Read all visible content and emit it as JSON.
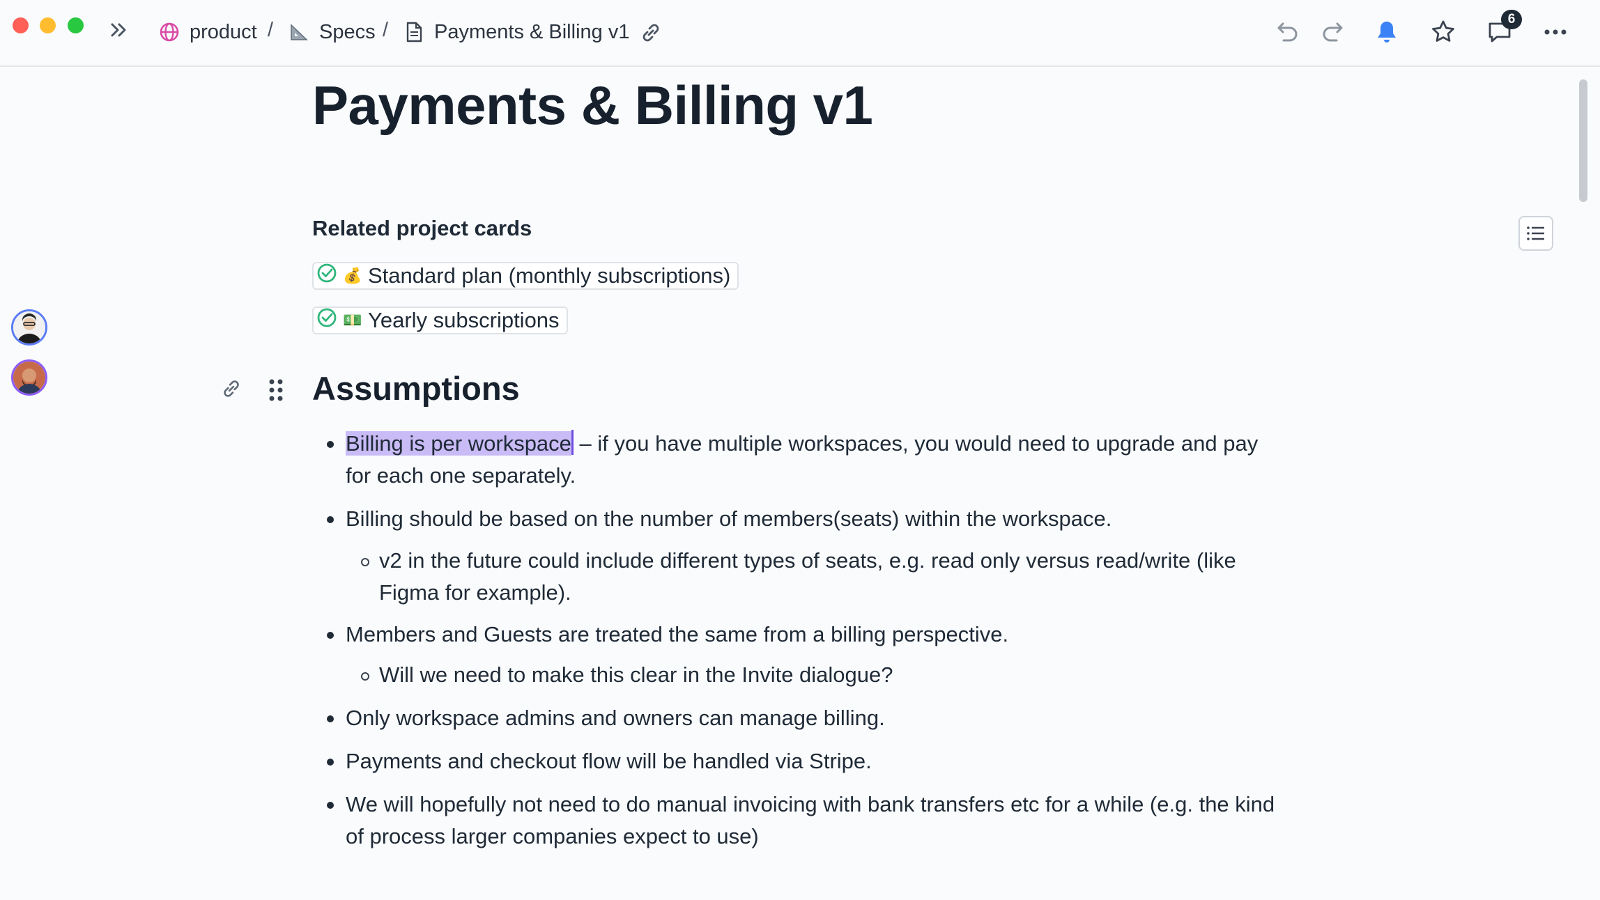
{
  "breadcrumb": {
    "workspace": "product",
    "folder": "Specs",
    "page": "Payments & Billing v1",
    "separator": "/"
  },
  "toolbar": {
    "comments_count": "6"
  },
  "document": {
    "title": "Payments & Billing v1",
    "related_heading": "Related project cards",
    "related_cards": [
      {
        "emoji": "💰",
        "label": "Standard plan (monthly subscriptions)",
        "status": "done"
      },
      {
        "emoji": "💵",
        "label": "Yearly subscriptions",
        "status": "done"
      }
    ],
    "section_heading": "Assumptions",
    "bullets": {
      "b1_highlight": "Billing is per workspace",
      "b1_rest": " – if you have multiple workspaces, you would need to upgrade and pay for each one separately.",
      "b2": "Billing should be based on the number of members(seats) within the workspace.",
      "b2_sub": "v2 in the future could include different types of seats, e.g. read only versus read/write (like Figma for example).",
      "b3": "Members and Guests are treated the same from a billing perspective.",
      "b3_sub": "Will we need to make this clear in the Invite dialogue?",
      "b4": "Only workspace admins and owners can manage billing.",
      "b5": "Payments and checkout flow will be handled via Stripe.",
      "b6": "We will hopefully not need to do manual invoicing with bank transfers etc for a while (e.g. the kind of process larger companies expect to use)"
    }
  },
  "colors": {
    "highlight": "#c9bbf5",
    "accent": "#5b7cf5",
    "check": "#2fb67c"
  }
}
